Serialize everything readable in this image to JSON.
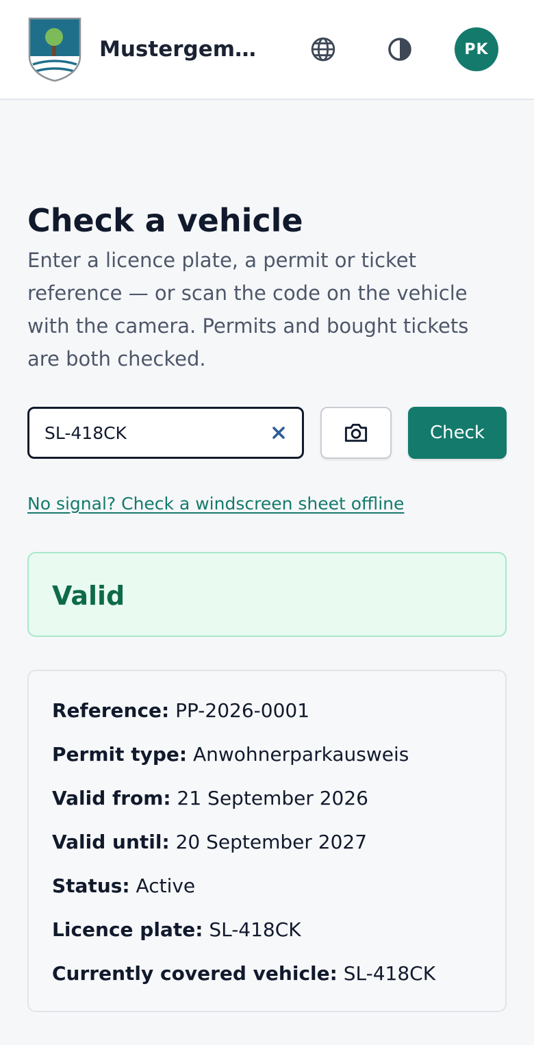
{
  "header": {
    "org_name": "Mustergemei...",
    "avatar_initials": "PK",
    "accent": "#147a6c"
  },
  "main": {
    "title": "Check a vehicle",
    "intro": "Enter a licence plate, a permit or ticket reference — or scan the code on the vehicle with the camera. Permits and bought tickets are both checked.",
    "search": {
      "value": "SL-418CK"
    },
    "check_label": "Check",
    "offline_link": "No signal? Check a windscreen sheet offline"
  },
  "result": {
    "status": "Valid",
    "status_color": "#0e6a4a",
    "details": [
      {
        "label": "Reference:",
        "value": "PP-2026-0001"
      },
      {
        "label": "Permit type:",
        "value": "Anwohnerparkausweis"
      },
      {
        "label": "Valid from:",
        "value": "21 September 2026"
      },
      {
        "label": "Valid until:",
        "value": "20 September 2027"
      },
      {
        "label": "Status:",
        "value": "Active"
      },
      {
        "label": "Licence plate:",
        "value": "SL-418CK"
      },
      {
        "label": "Currently covered vehicle:",
        "value": "SL-418CK"
      }
    ]
  },
  "icons": {
    "language": "globe-icon",
    "theme": "contrast-icon",
    "clear": "close-icon",
    "scan": "camera-icon"
  }
}
